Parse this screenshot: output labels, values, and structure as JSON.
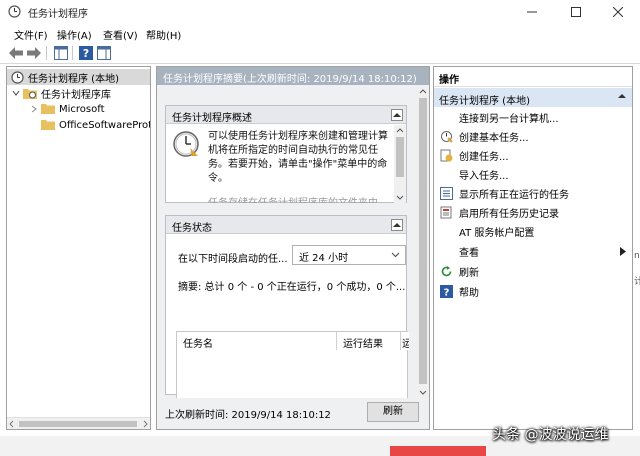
{
  "window": {
    "title": "任务计划程序"
  },
  "menu": {
    "items": [
      "文件(F)",
      "操作(A)",
      "查看(V)",
      "帮助(H)"
    ]
  },
  "tree": {
    "items": [
      {
        "label": "任务计划程序 (本地)"
      },
      {
        "label": "任务计划程序库"
      },
      {
        "label": "Microsoft"
      },
      {
        "label": "OfficeSoftwareProte"
      }
    ]
  },
  "main": {
    "header": "任务计划程序摘要(上次刷新时间: 2019/9/14 18:10:12)",
    "overview": {
      "title": "任务计划程序概述",
      "text": "可以使用任务计划程序来创建和管理计算机将在所指定的时间自动执行的常见任务。若要开始，请单击\"操作\"菜单中的命令。",
      "text_partial": "任务存储在任务计划程序库的文件夹中"
    },
    "status": {
      "title": "任务状态",
      "period_label": "在以下时间段启动的任...",
      "period_value": "近 24 小时",
      "summary": "摘要: 总计 0 个 - 0 个正在运行，0 个成功，0 个...",
      "columns": [
        "任务名",
        "运行结果",
        "运"
      ]
    },
    "footer": {
      "last_refresh": "上次刷新时间: 2019/9/14 18:10:12",
      "refresh_button": "刷新"
    }
  },
  "actions": {
    "title": "操作",
    "group": "任务计划程序 (本地)",
    "items": [
      {
        "label": "连接到另一台计算机...",
        "icon": "none"
      },
      {
        "label": "创建基本任务...",
        "icon": "wizard-icon"
      },
      {
        "label": "创建任务...",
        "icon": "task-icon"
      },
      {
        "label": "导入任务...",
        "icon": "none"
      },
      {
        "label": "显示所有正在运行的任务",
        "icon": "list-icon"
      },
      {
        "label": "启用所有任务历史记录",
        "icon": "history-icon"
      },
      {
        "label": "AT 服务帐户配置",
        "icon": "none"
      },
      {
        "label": "查看",
        "icon": "none"
      },
      {
        "label": "刷新",
        "icon": "refresh-icon"
      },
      {
        "label": "帮助",
        "icon": "help-icon"
      }
    ]
  },
  "edge": {
    "chars": "ne\n\n\n计\n\n\n\n\n\n"
  },
  "watermark": {
    "text": "头条 @波波说运维"
  }
}
